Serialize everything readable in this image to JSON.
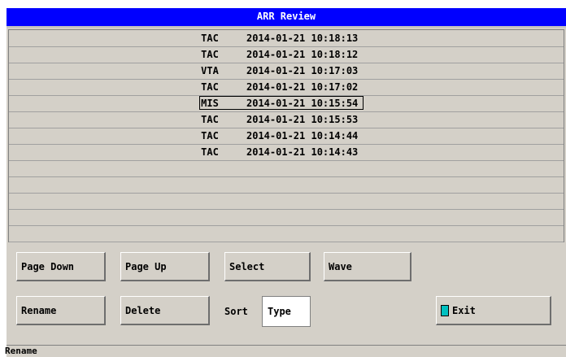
{
  "window": {
    "title": "ARR Review"
  },
  "records": [
    {
      "type": "TAC",
      "datetime": "2014-01-21 10:18:13"
    },
    {
      "type": "TAC",
      "datetime": "2014-01-21 10:18:12"
    },
    {
      "type": "VTA",
      "datetime": "2014-01-21 10:17:03"
    },
    {
      "type": "TAC",
      "datetime": "2014-01-21 10:17:02"
    },
    {
      "type": "MIS",
      "datetime": "2014-01-21 10:15:54",
      "selected": true
    },
    {
      "type": "TAC",
      "datetime": "2014-01-21 10:15:53"
    },
    {
      "type": "TAC",
      "datetime": "2014-01-21 10:14:44"
    },
    {
      "type": "TAC",
      "datetime": "2014-01-21 10:14:43"
    }
  ],
  "buttons": {
    "page_down": "Page Down",
    "page_up": "Page Up",
    "select": "Select",
    "wave": "Wave",
    "rename": "Rename",
    "delete": "Delete",
    "exit": "Exit"
  },
  "sort": {
    "label": "Sort",
    "value": "Type"
  },
  "status": {
    "text": "Rename"
  },
  "colors": {
    "titlebar": "#0000ff",
    "background": "#d4d0c8"
  }
}
